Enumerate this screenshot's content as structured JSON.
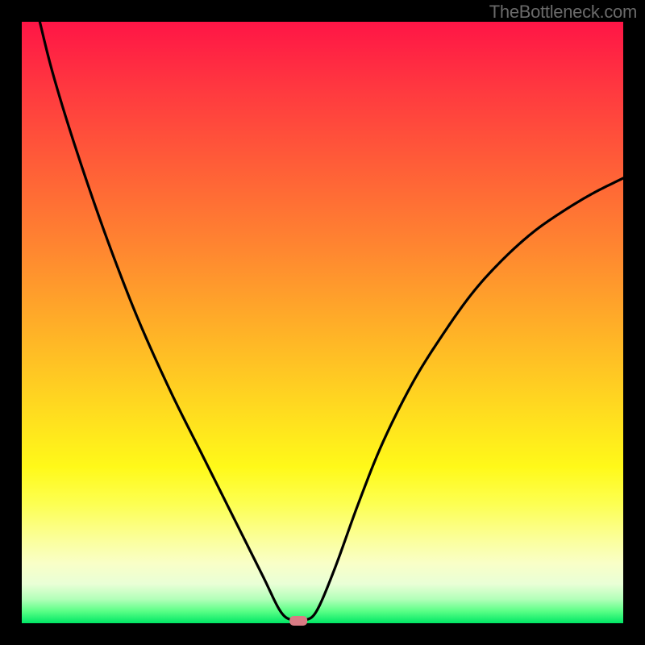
{
  "watermark": "TheBottleneck.com",
  "chart_data": {
    "type": "line",
    "title": "",
    "xlabel": "",
    "ylabel": "",
    "xlim": [
      0,
      100
    ],
    "ylim": [
      0,
      100
    ],
    "curve": {
      "description": "V-shaped bottleneck curve with minimum near x=45",
      "points": [
        {
          "x": 3.0,
          "y": 100.0
        },
        {
          "x": 5.0,
          "y": 92.0
        },
        {
          "x": 8.0,
          "y": 82.0
        },
        {
          "x": 12.0,
          "y": 70.0
        },
        {
          "x": 16.0,
          "y": 59.0
        },
        {
          "x": 20.0,
          "y": 49.0
        },
        {
          "x": 25.0,
          "y": 38.0
        },
        {
          "x": 30.0,
          "y": 28.0
        },
        {
          "x": 35.0,
          "y": 18.0
        },
        {
          "x": 40.0,
          "y": 8.0
        },
        {
          "x": 43.0,
          "y": 2.0
        },
        {
          "x": 45.0,
          "y": 0.5
        },
        {
          "x": 47.0,
          "y": 0.5
        },
        {
          "x": 49.0,
          "y": 2.0
        },
        {
          "x": 52.0,
          "y": 9.0
        },
        {
          "x": 56.0,
          "y": 20.0
        },
        {
          "x": 60.0,
          "y": 30.0
        },
        {
          "x": 65.0,
          "y": 40.0
        },
        {
          "x": 70.0,
          "y": 48.0
        },
        {
          "x": 75.0,
          "y": 55.0
        },
        {
          "x": 80.0,
          "y": 60.5
        },
        {
          "x": 85.0,
          "y": 65.0
        },
        {
          "x": 90.0,
          "y": 68.5
        },
        {
          "x": 95.0,
          "y": 71.5
        },
        {
          "x": 100.0,
          "y": 74.0
        }
      ]
    },
    "marker": {
      "x": 46.0,
      "y": 0.0,
      "color": "#d97b84"
    },
    "background_gradient": {
      "stops": [
        {
          "offset": 0.0,
          "color": "#ff1546"
        },
        {
          "offset": 0.12,
          "color": "#ff3b3f"
        },
        {
          "offset": 0.25,
          "color": "#ff6137"
        },
        {
          "offset": 0.38,
          "color": "#ff8730"
        },
        {
          "offset": 0.5,
          "color": "#ffad28"
        },
        {
          "offset": 0.62,
          "color": "#ffd321"
        },
        {
          "offset": 0.74,
          "color": "#fff919"
        },
        {
          "offset": 0.8,
          "color": "#fdff50"
        },
        {
          "offset": 0.86,
          "color": "#fbff9a"
        },
        {
          "offset": 0.9,
          "color": "#f9ffc7"
        },
        {
          "offset": 0.935,
          "color": "#e9ffd6"
        },
        {
          "offset": 0.96,
          "color": "#b2ffb9"
        },
        {
          "offset": 0.98,
          "color": "#5aff86"
        },
        {
          "offset": 1.0,
          "color": "#00e765"
        }
      ]
    },
    "frame": {
      "outer_size": 800,
      "border_width": 27,
      "border_color": "#000000"
    }
  }
}
